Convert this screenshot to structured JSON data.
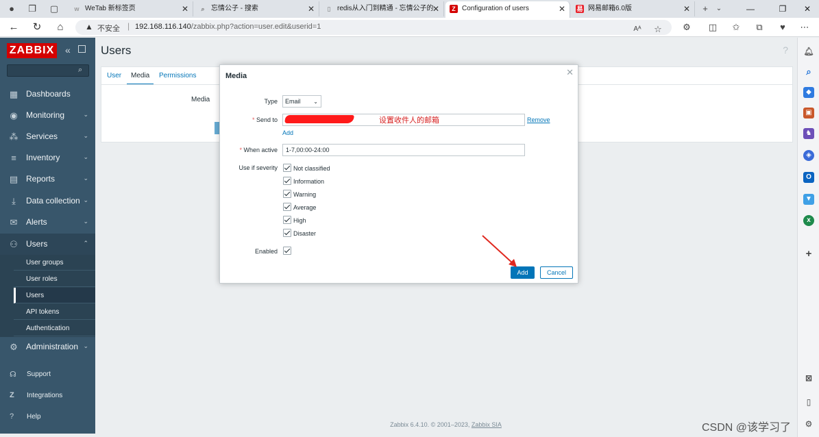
{
  "browser": {
    "tabs": [
      {
        "title": "WeTab 新标签页",
        "favicon": "ww"
      },
      {
        "title": "忘情公子 - 搜索",
        "favicon": "search"
      },
      {
        "title": "redis从入门到精通 - 忘情公子的",
        "favicon": "doc"
      },
      {
        "title": "Configuration of users",
        "favicon": "Z",
        "active": true
      },
      {
        "title": "网易邮箱6.0版",
        "favicon": "163"
      }
    ],
    "address": {
      "insecure_label": "不安全",
      "host": "192.168.116.140",
      "path": "/zabbix.php?action=user.edit&userid=1"
    }
  },
  "sidebar": {
    "logo": "ZABBIX",
    "menu": [
      {
        "label": "Dashboards",
        "icon": "dashboard-icon",
        "glyph": "▦"
      },
      {
        "label": "Monitoring",
        "icon": "eye-icon",
        "glyph": "◉",
        "chevron": true
      },
      {
        "label": "Services",
        "icon": "services-icon",
        "glyph": "⁂",
        "chevron": true
      },
      {
        "label": "Inventory",
        "icon": "list-icon",
        "glyph": "≡",
        "chevron": true
      },
      {
        "label": "Reports",
        "icon": "reports-icon",
        "glyph": "▤",
        "chevron": true
      },
      {
        "label": "Data collection",
        "icon": "download-icon",
        "glyph": "⤓",
        "chevron": true
      },
      {
        "label": "Alerts",
        "icon": "mail-icon",
        "glyph": "✉",
        "chevron": true
      },
      {
        "label": "Users",
        "icon": "users-icon",
        "glyph": "⚇",
        "chevron": true,
        "open": true
      }
    ],
    "users_submenu": [
      "User groups",
      "User roles",
      "Users",
      "API tokens",
      "Authentication"
    ],
    "active_submenu": "Users",
    "administration": {
      "label": "Administration",
      "icon": "gear-icon",
      "glyph": "⚙"
    },
    "bottom": [
      {
        "label": "Support",
        "icon": "headset-icon",
        "glyph": "☊"
      },
      {
        "label": "Integrations",
        "icon": "integrations-icon",
        "glyph": "Z"
      },
      {
        "label": "Help",
        "icon": "help-icon",
        "glyph": "?"
      }
    ]
  },
  "main": {
    "title": "Users",
    "tabs": [
      "User",
      "Media",
      "Permissions"
    ],
    "active_tab": "Media",
    "media_label": "Media",
    "footer": {
      "text": "Zabbix 6.4.10. © 2001–2023, ",
      "link": "Zabbix SIA"
    }
  },
  "modal": {
    "title": "Media",
    "type_label": "Type",
    "type_value": "Email",
    "sendto_label": "Send to",
    "sendto_annotation": "设置收件人的邮箱",
    "remove_label": "Remove",
    "add_link_label": "Add",
    "when_active_label": "When active",
    "when_active_value": "1-7,00:00-24:00",
    "severity_label": "Use if severity",
    "severities": [
      "Not classified",
      "Information",
      "Warning",
      "Average",
      "High",
      "Disaster"
    ],
    "enabled_label": "Enabled",
    "add_button": "Add",
    "cancel_button": "Cancel"
  },
  "watermark": "CSDN @该学习了",
  "colors": {
    "zabbix_red": "#d40000",
    "sidebar_bg": "#38566b",
    "link_blue": "#0275b8",
    "annotation_red": "#d61f1f"
  }
}
